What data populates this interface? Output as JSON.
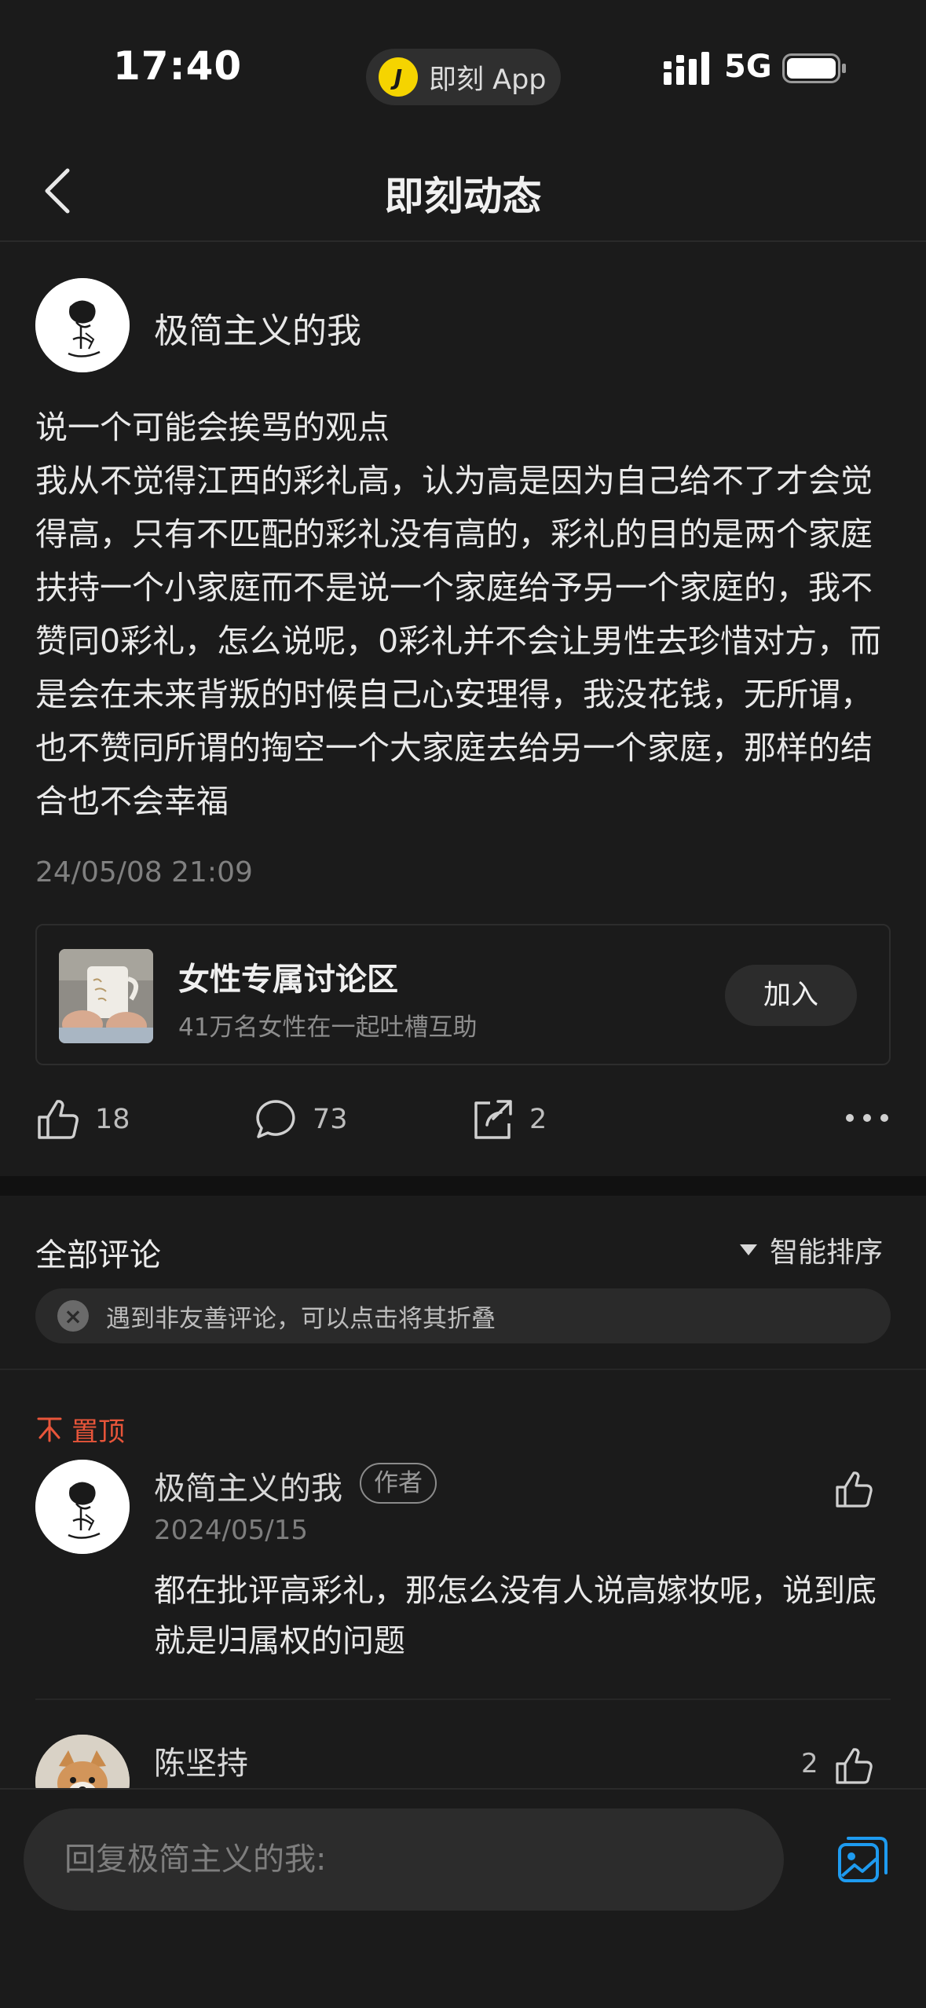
{
  "status_bar": {
    "time": "17:40",
    "app_label": "即刻 App",
    "app_icon_letter": "J",
    "network": "5G"
  },
  "header": {
    "title": "即刻动态"
  },
  "post": {
    "author": "极简主义的我",
    "body": "说一个可能会挨骂的观点\n我从不觉得江西的彩礼高，认为高是因为自己给不了才会觉得高，只有不匹配的彩礼没有高的，彩礼的目的是两个家庭扶持一个小家庭而不是说一个家庭给予另一个家庭的，我不赞同0彩礼，怎么说呢，0彩礼并不会让男性去珍惜对方，而是会在未来背叛的时候自己心安理得，我没花钱，无所谓，也不赞同所谓的掏空一个大家庭去给另一个家庭，那样的结合也不会幸福",
    "time": "24/05/08 21:09",
    "group": {
      "name": "女性专属讨论区",
      "subtitle": "41万名女性在一起吐槽互助",
      "join_label": "加入"
    },
    "likes": "18",
    "comments": "73",
    "shares": "2"
  },
  "comments": {
    "title": "全部评论",
    "sort_label": "智能排序",
    "notice": "遇到非友善评论，可以点击将其折叠",
    "pinned_label": "置顶",
    "items": [
      {
        "author": "极简主义的我",
        "tag": "作者",
        "date": "2024/05/15",
        "body": "都在批评高彩礼，那怎么没有人说高嫁妆呢，说到底就是归属权的问题"
      },
      {
        "author": "陈坚持",
        "likes": "2"
      }
    ]
  },
  "reply_bar": {
    "placeholder": "回复极简主义的我:"
  },
  "colors": {
    "background": "#1b1b1b",
    "accent_red": "#e8553a",
    "accent_blue": "#1e9bf0",
    "jike_yellow": "#f5d400"
  }
}
